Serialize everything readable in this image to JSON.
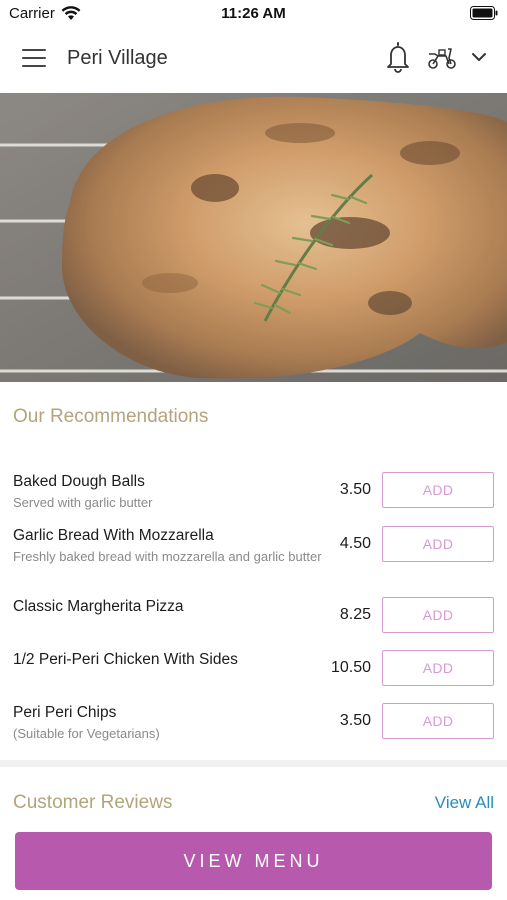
{
  "status_bar": {
    "carrier": "Carrier",
    "time": "11:26 AM"
  },
  "header": {
    "title": "Peri Village",
    "icons": [
      "menu-icon",
      "bell-icon",
      "scooter-icon",
      "chevron-down-icon"
    ]
  },
  "hero": {
    "image": "grilled chicken with rosemary on grill"
  },
  "recommendations": {
    "title": "Our Recommendations",
    "add_label": "ADD",
    "items": [
      {
        "name": "Baked Dough Balls",
        "description": "Served with garlic butter",
        "price": "3.50"
      },
      {
        "name": "Garlic Bread With Mozzarella",
        "description": "Freshly baked bread with mozzarella and garlic butter",
        "price": "4.50"
      },
      {
        "name": "Classic Margherita Pizza",
        "description": "",
        "price": "8.25"
      },
      {
        "name": "1/2 Peri-Peri Chicken With Sides",
        "description": "",
        "price": "10.50"
      },
      {
        "name": "Peri Peri Chips",
        "description": "(Suitable for Vegetarians)",
        "price": "3.50"
      }
    ]
  },
  "reviews": {
    "title": "Customer Reviews",
    "view_all": "View All"
  },
  "footer": {
    "view_menu": "VIEW MENU"
  },
  "colors": {
    "accent": "#b75aad",
    "add_border": "#d79bd4",
    "section_title": "#b4a47c",
    "link": "#2a8bbf"
  }
}
